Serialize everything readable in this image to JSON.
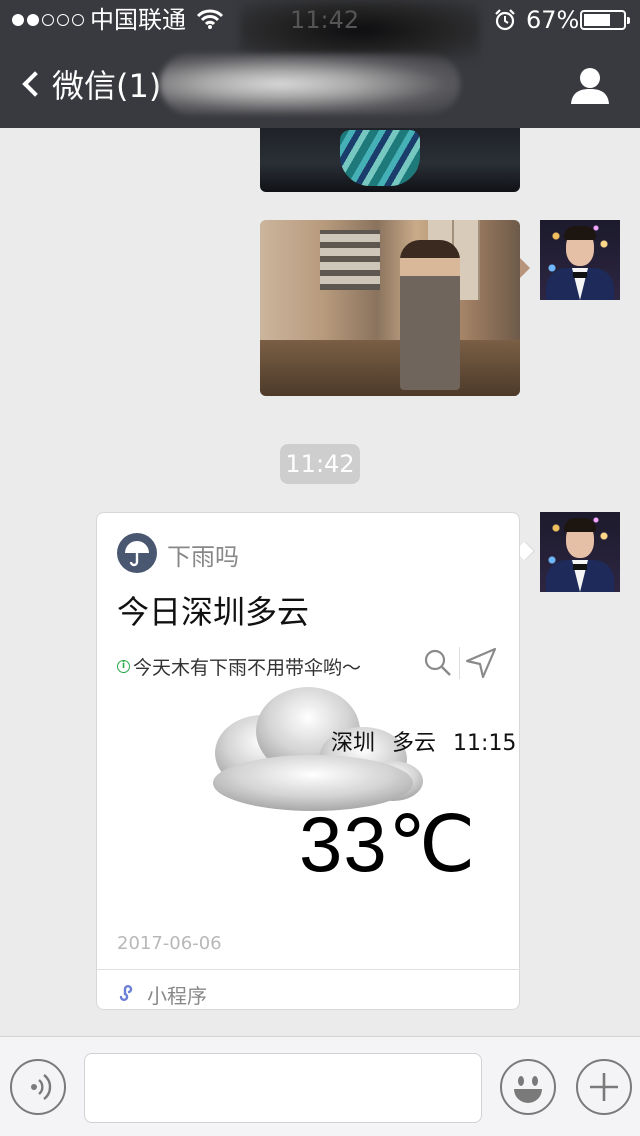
{
  "status_bar": {
    "signal_dots": [
      "on",
      "on",
      "off",
      "off",
      "off"
    ],
    "carrier": "中国联通",
    "time": "11:42",
    "battery_percent": "67%",
    "battery_level": 0.67
  },
  "nav": {
    "back_label": "微信(1)",
    "title_blurred": true
  },
  "chat": {
    "time_divider": "11:42",
    "messages": [
      {
        "type": "image",
        "sender": "self",
        "description": "partial image, scrolled off top"
      },
      {
        "type": "image",
        "sender": "self"
      },
      {
        "type": "mini_program_card",
        "sender": "self",
        "app_name": "下雨吗",
        "title": "今日深圳多云",
        "tip": "今天木有下雨不用带伞哟～",
        "city": "深圳",
        "condition": "多云",
        "update_time": "11:15",
        "temperature": "33℃",
        "date": "2017-06-06",
        "footer_label": "小程序"
      }
    ]
  },
  "input_bar": {
    "text_value": ""
  },
  "colors": {
    "nav_bg": "#393a3f",
    "chat_bg": "#ebebeb",
    "time_pill_bg": "#cecece",
    "tip_icon": "#2aaa48",
    "mini_program_icon": "#6b7fd6"
  }
}
